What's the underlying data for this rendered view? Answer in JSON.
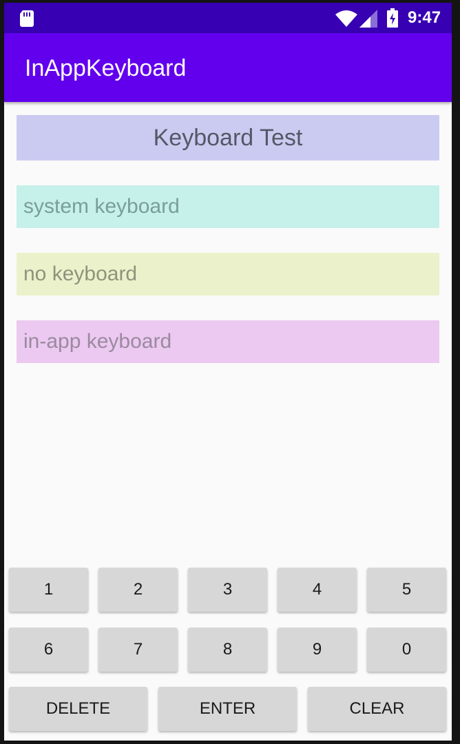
{
  "status_bar": {
    "time": "9:47",
    "icons": [
      "sd-card-icon",
      "wifi-icon",
      "signal-icon",
      "battery-charging-icon"
    ]
  },
  "app_bar": {
    "title": "InAppKeyboard"
  },
  "content": {
    "title": "Keyboard Test",
    "fields": [
      {
        "placeholder": "system keyboard"
      },
      {
        "placeholder": "no keyboard"
      },
      {
        "placeholder": "in-app keyboard"
      }
    ]
  },
  "keyboard": {
    "row1": [
      "1",
      "2",
      "3",
      "4",
      "5"
    ],
    "row2": [
      "6",
      "7",
      "8",
      "9",
      "0"
    ],
    "row3": [
      "DELETE",
      "ENTER",
      "CLEAR"
    ]
  },
  "colors": {
    "status_bar": "#3700b3",
    "app_bar": "#6200ee",
    "title_box": "#cbcbf1",
    "field_system": "#c6f0ea",
    "field_none": "#ebf2cb",
    "field_inapp": "#ecc9f0",
    "key": "#d7d7d7"
  }
}
